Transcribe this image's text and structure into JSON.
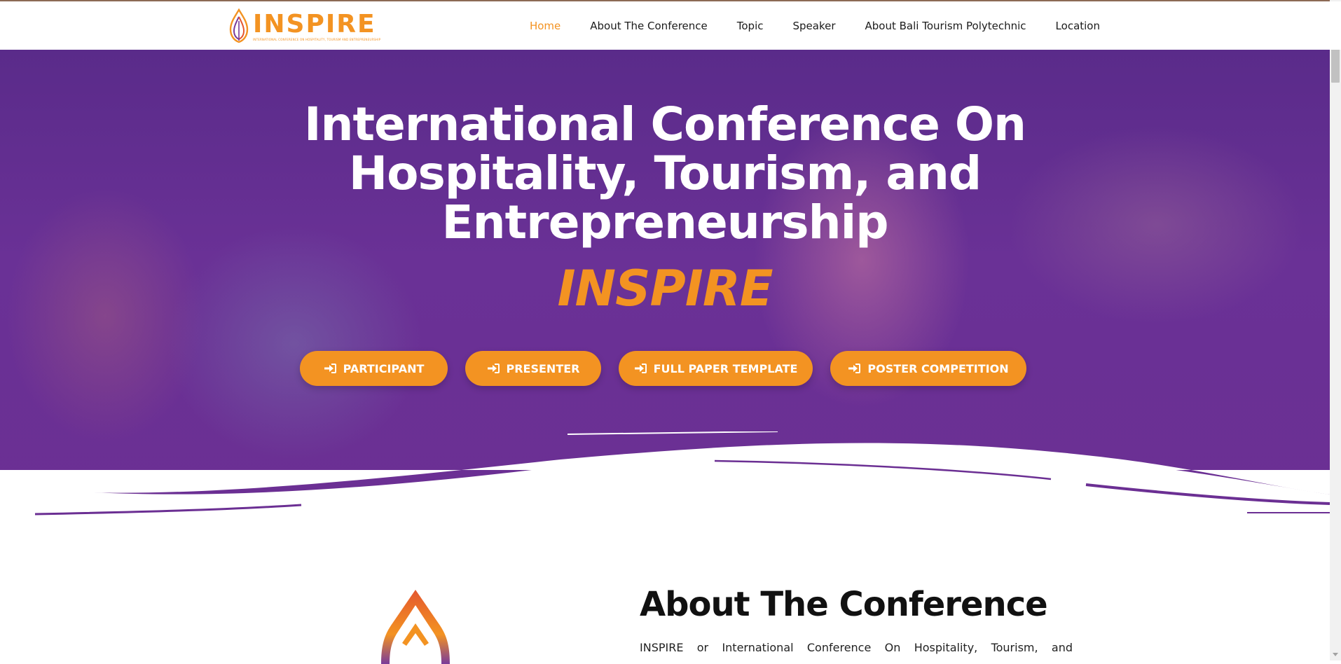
{
  "header": {
    "logo_text": "INSPIRE",
    "logo_subtitle": "INTERNATIONAL CONFERENCE ON HOSPITALITY, TOURISM AND ENTREPRENEURSHIP",
    "nav": [
      {
        "label": "Home",
        "active": true
      },
      {
        "label": "About The Conference",
        "active": false
      },
      {
        "label": "Topic",
        "active": false
      },
      {
        "label": "Speaker",
        "active": false
      },
      {
        "label": "About Bali Tourism Polytechnic",
        "active": false
      },
      {
        "label": "Location",
        "active": false
      }
    ]
  },
  "hero": {
    "title_line1": "International Conference On",
    "title_line2": "Hospitality, Tourism, and",
    "title_line3": "Entrepreneurship",
    "subtitle": "INSPIRE",
    "buttons": [
      {
        "label": "PARTICIPANT",
        "icon": "sign-in-icon"
      },
      {
        "label": "PRESENTER",
        "icon": "sign-in-icon"
      },
      {
        "label": "FULL PAPER TEMPLATE",
        "icon": "sign-in-icon"
      },
      {
        "label": "POSTER COMPETITION",
        "icon": "sign-in-icon"
      }
    ]
  },
  "about": {
    "heading": "About The Conference",
    "text": "INSPIRE or International Conference On Hospitality, Tourism, and"
  },
  "colors": {
    "accent": "#f39322",
    "hero_overlay": "#6a3196",
    "text_dark": "#1b1b1b"
  }
}
